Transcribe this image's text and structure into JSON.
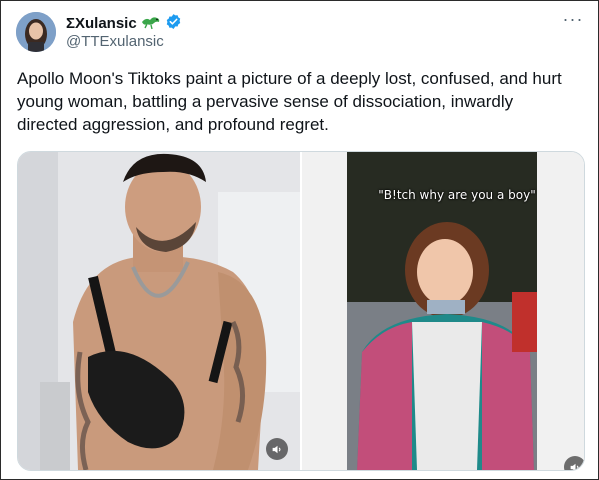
{
  "author": {
    "display_name": "ΣXulansic",
    "handle": "@TTExulansic",
    "badge_icon": "lizard-emoji-icon",
    "verified_icon": "verified-badge-icon",
    "verified_color": "#1d9bf0"
  },
  "tweet": {
    "text": "Apollo Moon's Tiktoks paint a picture of a deeply lost, confused, and hurt young woman, battling a pervasive sense of dissociation, inwardly directed aggression, and profound regret."
  },
  "media": {
    "right_caption": "\"B!tch why are you a boy\"",
    "mute_icon": "speaker-icon"
  },
  "menu": {
    "more_label": "···"
  }
}
